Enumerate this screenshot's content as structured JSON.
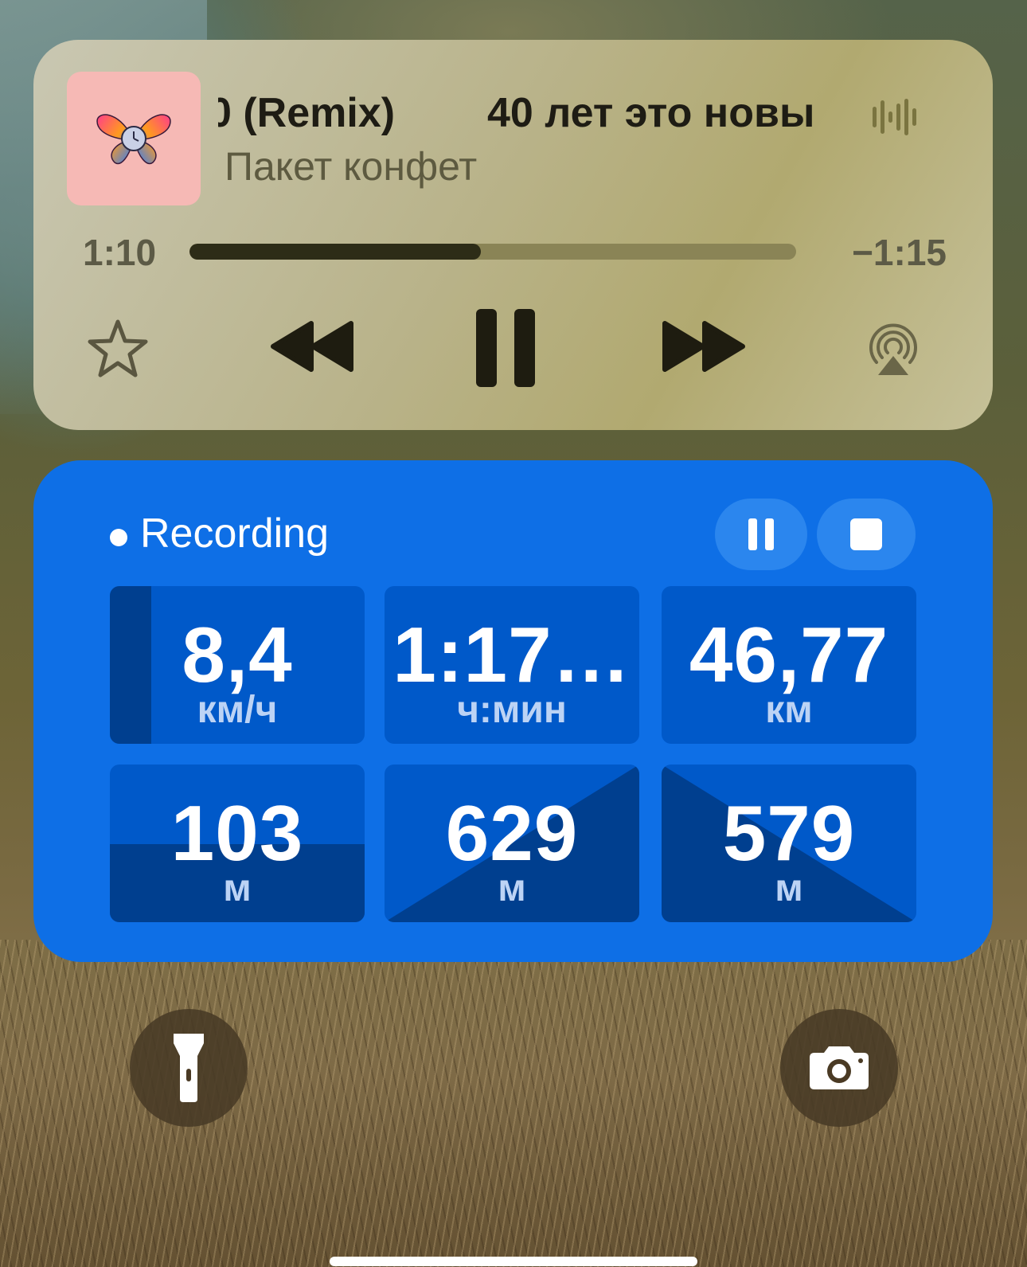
{
  "now_playing": {
    "title_part_a": "0 (Remix)",
    "title_part_b": "40 лет это новы",
    "artist": "Пакет конфет",
    "elapsed": "1:10",
    "remaining": "−1:15",
    "progress_percent": 48,
    "icons": [
      "butterfly-icon",
      "waveform-icon",
      "star-icon",
      "rewind-icon",
      "pause-icon",
      "fast-forward-icon",
      "airplay-icon"
    ]
  },
  "activity": {
    "status_label": "Recording",
    "accent_color": "#0e6fe6",
    "metrics": [
      {
        "value": "8,4",
        "unit": "км/ч"
      },
      {
        "value": "1:17…",
        "unit": "ч:мин"
      },
      {
        "value": "46,77",
        "unit": "км"
      },
      {
        "value": "103",
        "unit": "м"
      },
      {
        "value": "629",
        "unit": "м"
      },
      {
        "value": "579",
        "unit": "м"
      }
    ]
  },
  "lock_screen": {
    "icons": [
      "flashlight-icon",
      "camera-icon"
    ]
  }
}
